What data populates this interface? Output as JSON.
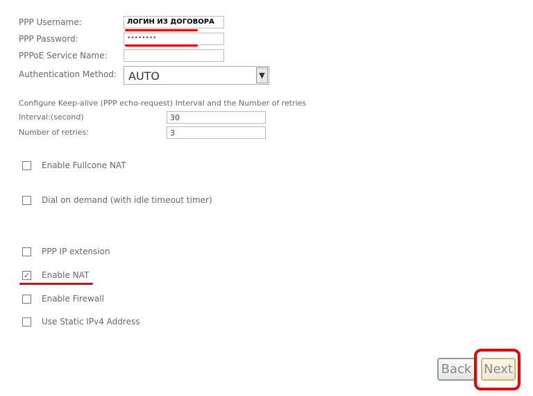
{
  "form": {
    "username_label": "PPP Username:",
    "username_value": "ЛОГИН ИЗ ДОГОВОРА",
    "password_label": "PPP Password:",
    "password_value": "••••••••",
    "service_label": "PPPoE Service Name:",
    "service_value": "",
    "auth_label": "Authentication Method:",
    "auth_value": "AUTO",
    "keepalive_text": "Configure Keep-alive (PPP echo-request) Interval and the Number of retries",
    "interval_label": "Interval:(second)",
    "interval_value": "30",
    "retries_label": "Number of retries:",
    "retries_value": "3"
  },
  "checkboxes": [
    {
      "label": "Enable Fullcone NAT",
      "checked": false
    },
    {
      "label": "Dial on demand (with idle timeout timer)",
      "checked": false
    },
    {
      "label": "PPP IP extension",
      "checked": false
    },
    {
      "label": "Enable NAT",
      "checked": true
    },
    {
      "label": "Enable Firewall",
      "checked": false
    },
    {
      "label": "Use Static IPv4 Address",
      "checked": false
    }
  ],
  "buttons": {
    "back": "Back",
    "next": "Next"
  },
  "colors": {
    "highlight": "#e00000"
  }
}
